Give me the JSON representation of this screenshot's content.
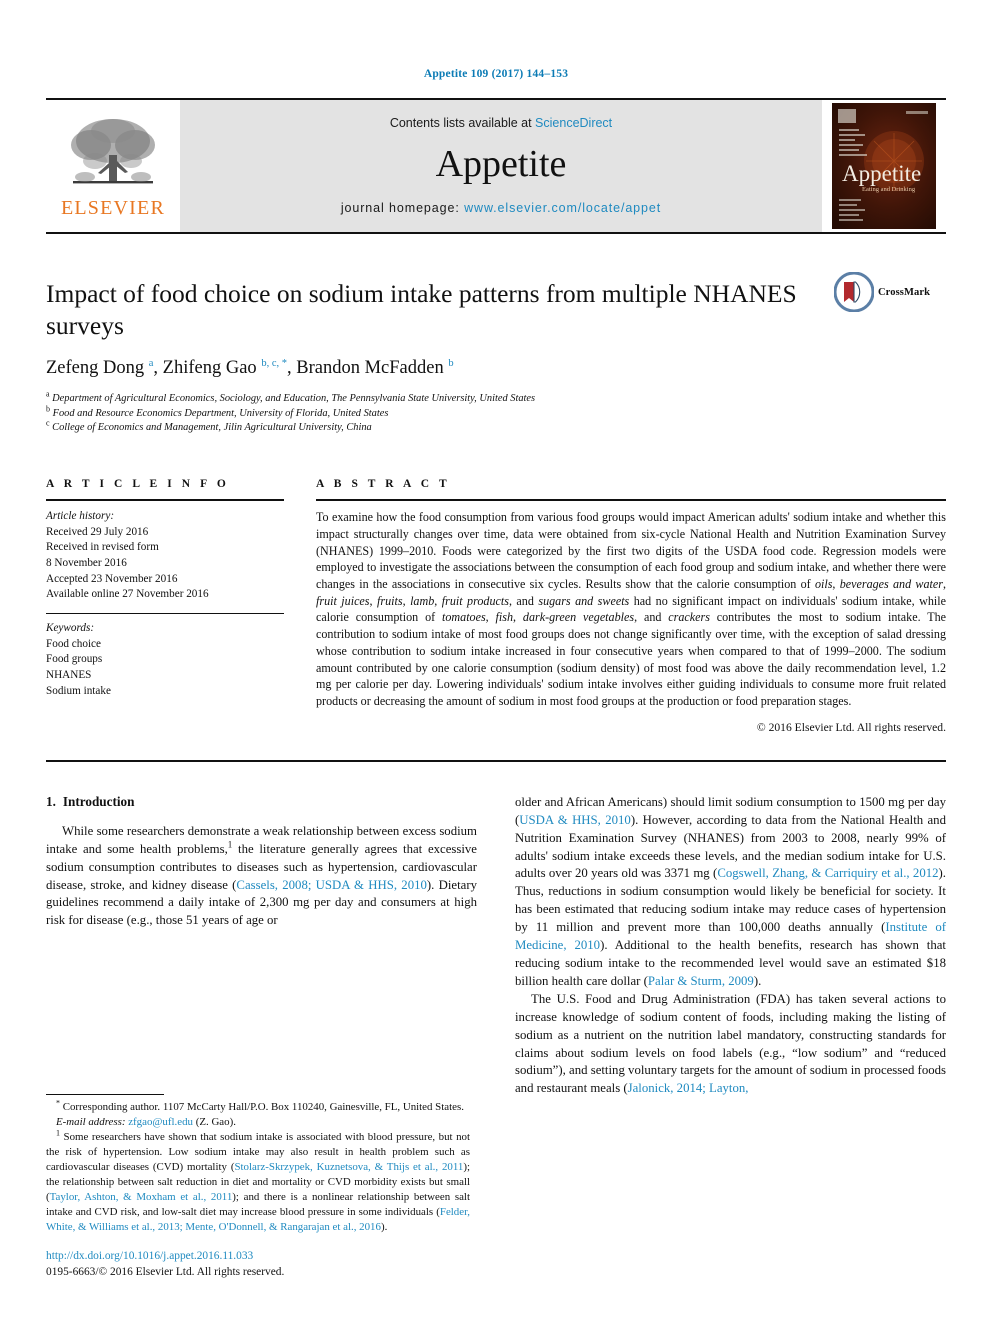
{
  "running_head": "Appetite 109 (2017) 144–153",
  "masthead": {
    "publisher_logo_label": "ELSEVIER",
    "contents_prefix": "Contents lists available at ",
    "contents_link": "ScienceDirect",
    "journal_name": "Appetite",
    "homepage_prefix": "journal homepage: ",
    "homepage_url": "www.elsevier.com/locate/appet",
    "cover_title": "Appetite",
    "cover_subtitle": "Eating and Drinking"
  },
  "crossmark": {
    "label": "CrossMark",
    "accent": "#b2292e"
  },
  "article": {
    "title": "Impact of food choice on sodium intake patterns from multiple NHANES surveys",
    "authors_html": "Zefeng Dong <sup>a</sup>, Zhifeng Gao <sup>b, c, *</sup>, Brandon McFadden <sup>b</sup>",
    "affiliations": [
      {
        "mark": "a",
        "text": "Department of Agricultural Economics, Sociology, and Education, The Pennsylvania State University, United States"
      },
      {
        "mark": "b",
        "text": "Food and Resource Economics Department, University of Florida, United States"
      },
      {
        "mark": "c",
        "text": "College of Economics and Management, Jilin Agricultural University, China"
      }
    ]
  },
  "article_info": {
    "heading": "A R T I C L E  I N F O",
    "history_label": "Article history:",
    "history_lines": [
      "Received 29 July 2016",
      "Received in revised form",
      "8 November 2016",
      "Accepted 23 November 2016",
      "Available online 27 November 2016"
    ],
    "keywords_label": "Keywords:",
    "keywords": [
      "Food choice",
      "Food groups",
      "NHANES",
      "Sodium intake"
    ]
  },
  "abstract": {
    "heading": "A B S T R A C T",
    "text_html": "To examine how the food consumption from various food groups would impact American adults' sodium intake and whether this impact structurally changes over time, data were obtained from six-cycle National Health and Nutrition Examination Survey (NHANES) 1999–2010. Foods were categorized by the first two digits of the USDA food code. Regression models were employed to investigate the associations between the consumption of each food group and sodium intake, and whether there were changes in the associations in consecutive six cycles. Results show that the calorie consumption of <i>oils</i>, <i>beverages and water</i>, <i>fruit juices</i>, <i>fruits</i>, <i>lamb</i>, <i>fruit products</i>, and <i>sugars and sweets</i> had no significant impact on individuals' sodium intake, while calorie consumption of <i>tomatoes</i>, <i>fish</i>, <i>dark-green vegetables</i>, and <i>crackers</i> contributes the most to sodium intake. The contribution to sodium intake of most food groups does not change significantly over time, with the exception of salad dressing whose contribution to sodium intake increased in four consecutive years when compared to that of 1999–2000. The sodium amount contributed by one calorie consumption (sodium density) of most food was above the daily recommendation level, 1.2 mg per calorie per day. Lowering individuals' sodium intake involves either guiding individuals to consume more fruit related products or decreasing the amount of sodium in most food groups at the production or food preparation stages.",
    "copyright": "© 2016 Elsevier Ltd. All rights reserved."
  },
  "introduction": {
    "number": "1.",
    "heading": "Introduction",
    "left_paragraph_html": "While some researchers demonstrate a weak relationship between excess sodium intake and some health problems,<sup class=\"fn\">1</sup> the literature generally agrees that excessive sodium consumption contributes to diseases such as hypertension, cardiovascular disease, stroke, and kidney disease (<span class=\"ref\">Cassels, 2008; USDA &amp; HHS, 2010</span>). Dietary guidelines recommend a daily intake of 2,300 mg per day and consumers at high risk for disease (e.g., those 51 years of age or",
    "right_paragraph_1_html": "older and African Americans) should limit sodium consumption to 1500 mg per day (<span class=\"ref\">USDA &amp; HHS, 2010</span>). However, according to data from the National Health and Nutrition Examination Survey (NHANES) from 2003 to 2008, nearly 99% of adults' sodium intake exceeds these levels, and the median sodium intake for U.S. adults over 20 years old was 3371 mg (<span class=\"ref\">Cogswell, Zhang, &amp; Carriquiry et al., 2012</span>). Thus, reductions in sodium consumption would likely be beneficial for society. It has been estimated that reducing sodium intake may reduce cases of hypertension by 11 million and prevent more than 100,000 deaths annually (<span class=\"ref\">Institute of Medicine, 2010</span>). Additional to the health benefits, research has shown that reducing sodium intake to the recommended level would save an estimated $18 billion health care dollar (<span class=\"ref\">Palar &amp; Sturm, 2009</span>).",
    "right_paragraph_2_html": "The U.S. Food and Drug Administration (FDA) has taken several actions to increase knowledge of sodium content of foods, including making the listing of sodium as a nutrient on the nutrition label mandatory, constructing standards for claims about sodium levels on food labels (e.g., “low sodium” and “reduced sodium”), and setting voluntary targets for the amount of sodium in processed foods and restaurant meals (<span class=\"ref\">Jalonick, 2014; Layton,</span>"
  },
  "footnotes": {
    "corresponding_html": "<span class=\"fn-mark\">*</span> Corresponding author. 1107 McCarty Hall/P.O. Box 110240, Gainesville, FL, United States.",
    "email_label": "E-mail address:",
    "email": "zfgao@ufl.edu",
    "email_owner": "(Z. Gao).",
    "note1_html": "<span class=\"fn-mark\">1</span> Some researchers have shown that sodium intake is associated with blood pressure, but not the risk of hypertension. Low sodium intake may also result in health problem such as cardiovascular diseases (CVD) mortality (<span class=\"ref\">Stolarz-Skrzypek, Kuznetsova, &amp; Thijs et al., 2011</span>); the relationship between salt reduction in diet and mortality or CVD morbidity exists but small (<span class=\"ref\">Taylor, Ashton, &amp; Moxham et al., 2011</span>); and there is a nonlinear relationship between salt intake and CVD risk, and low-salt diet may increase blood pressure in some individuals (<span class=\"ref\">Felder, White, &amp; Williams et al., 2013; Mente, O'Donnell, &amp; Rangarajan et al., 2016</span>)."
  },
  "publication_footer": {
    "doi": "http://dx.doi.org/10.1016/j.appet.2016.11.033",
    "issn_line": "0195-6663/© 2016 Elsevier Ltd. All rights reserved."
  },
  "colors": {
    "link_blue": "#1f8ac0",
    "elsevier_orange": "#e87722",
    "masthead_gray": "#e3e3e3"
  }
}
